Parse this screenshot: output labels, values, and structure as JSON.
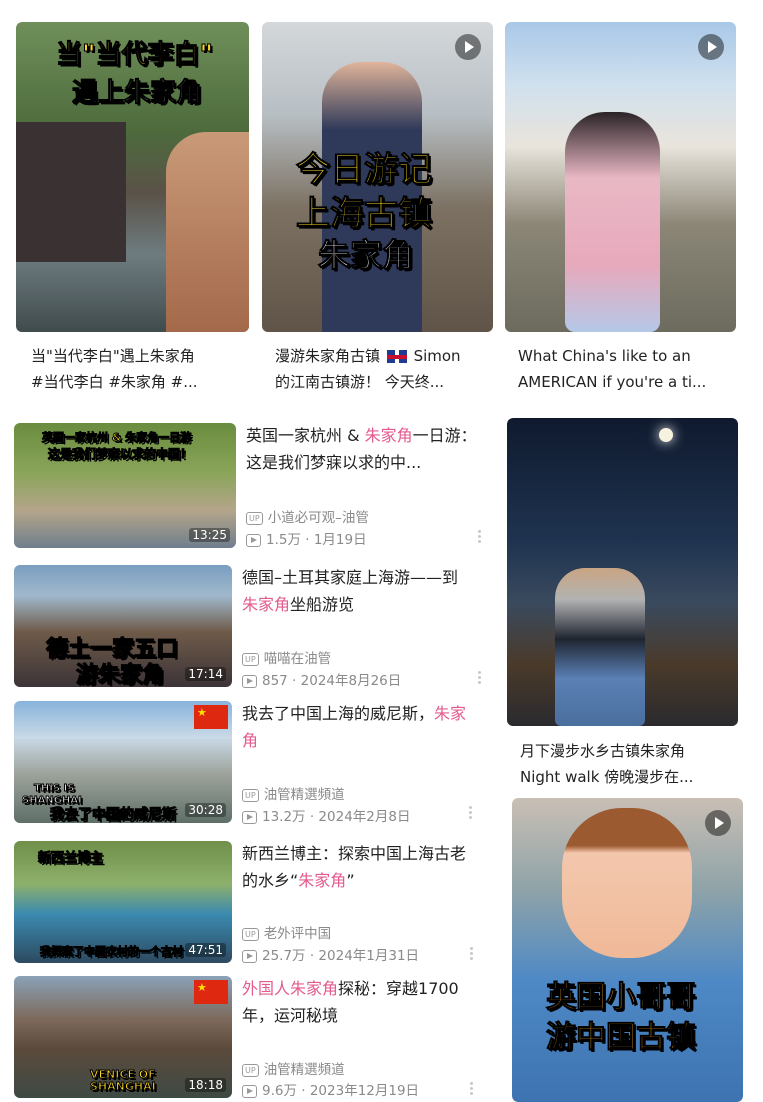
{
  "top_cards": [
    {
      "overlay_line1": "当\"当代李白\"",
      "overlay_line2": "遇上朱家角",
      "cap_line1": "当\"当代李白\"遇上朱家角",
      "cap_line2": "#当代李白 #朱家角 #..."
    },
    {
      "overlay_line1": "今日游记",
      "overlay_line2": "上海古镇",
      "overlay_line3": "朱家角",
      "cap_line1_a": "漫游朱家角古镇",
      "cap_line1_b": "Simon",
      "cap_line2": "的江南古镇游！ 今天终..."
    },
    {
      "cap_line1": "What China's like to an",
      "cap_line2": "AMERICAN if you're a ti..."
    }
  ],
  "videos": [
    {
      "thumb_overlay_line1": "英国一家杭州 & 朱家角一日游",
      "thumb_overlay_line2": "这是我们梦寐以求的中国！",
      "duration": "13:25",
      "title_before": "英国一家杭州 & ",
      "title_hl": "朱家角",
      "title_after": "一日游：这是我们梦寐以求的中...",
      "channel": "小道必可观–油管",
      "stats": "1.5万 · 1月19日"
    },
    {
      "thumb_overlay_line1": "德土一家五口",
      "thumb_overlay_line2": "游朱家角",
      "duration": "17:14",
      "title_before": "德国–土耳其家庭上海游——到",
      "title_hl": "朱家角",
      "title_after": "坐船游览",
      "channel": "喵喵在油管",
      "stats": "857 · 2024年8月26日"
    },
    {
      "thumb_overlay_line1": "THIS IS",
      "thumb_overlay_line2": "SHANGHAI",
      "thumb_overlay_line3": "我去了中国的威尼斯",
      "duration": "30:28",
      "title_before": "我去了中国上海的威尼斯，",
      "title_hl": "朱家角",
      "title_after": "",
      "channel": "油管精選頻道",
      "stats": "13.2万 · 2024年2月8日"
    },
    {
      "thumb_overlay_line1": "新西兰博主",
      "thumb_overlay_line2": "我探索了中国农村的一个古村",
      "duration": "47:51",
      "title_before": "新西兰博主：探索中国上海古老的水乡“",
      "title_hl": "朱家角",
      "title_after": "”",
      "channel": "老外评中国",
      "stats": "25.7万 · 2024年1月31日"
    },
    {
      "thumb_overlay_line1": "VENICE OF",
      "thumb_overlay_line2": "SHANGHAI",
      "duration": "18:18",
      "title_before": "",
      "title_hl": "外国人朱家角",
      "title_after": "探秘：穿越1700年，运河秘境",
      "channel": "油管精選頻道",
      "stats": "9.6万 · 2023年12月19日"
    }
  ],
  "right_cards": [
    {
      "cap_line1": "月下漫步水乡古镇朱家角",
      "cap_line2": "Night walk 傍晚漫步在..."
    },
    {
      "overlay_line1": "英国小哥哥",
      "overlay_line2": "游中国古镇"
    }
  ],
  "icons": {
    "up": "UP",
    "accent": "#e35b8f"
  }
}
